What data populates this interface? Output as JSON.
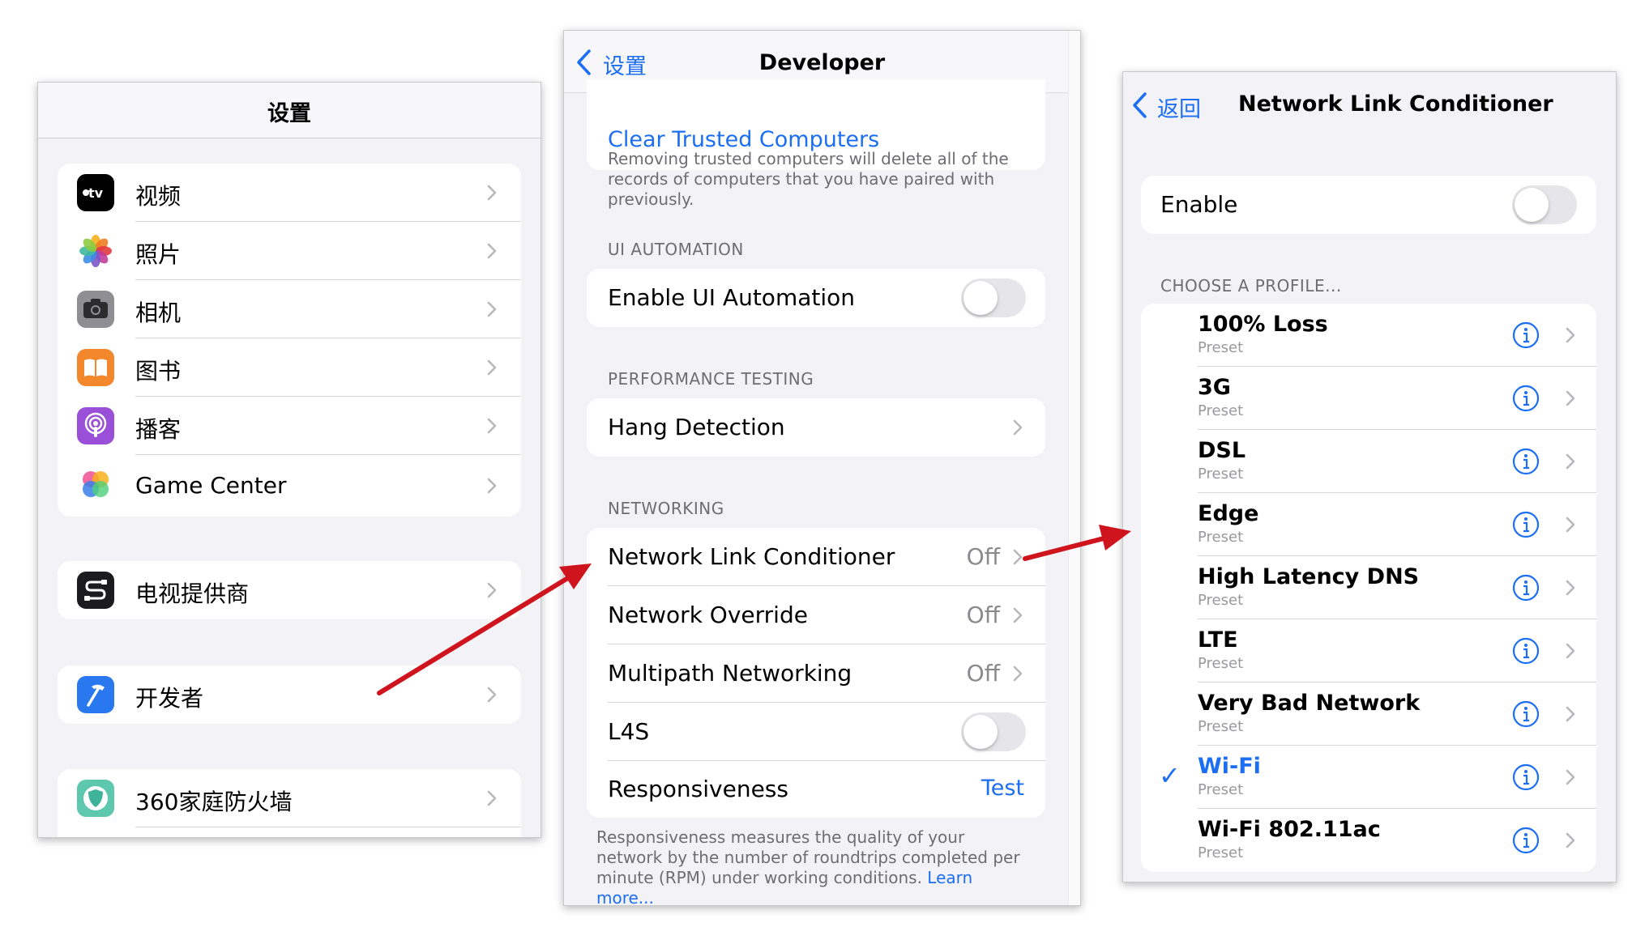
{
  "settings": {
    "title": "设置",
    "group1": [
      {
        "label": "视频",
        "icon": "apple-tv-icon"
      },
      {
        "label": "照片",
        "icon": "photos-icon"
      },
      {
        "label": "相机",
        "icon": "camera-icon"
      },
      {
        "label": "图书",
        "icon": "books-icon"
      },
      {
        "label": "播客",
        "icon": "podcasts-icon"
      },
      {
        "label": "Game Center",
        "icon": "game-center-icon"
      }
    ],
    "tv_provider": {
      "label": "电视提供商",
      "icon": "tv-provider-icon"
    },
    "developer": {
      "label": "开发者",
      "icon": "developer-hammer-icon"
    },
    "firewall": {
      "label": "360家庭防火墙",
      "icon": "firewall-shield-icon"
    }
  },
  "developer_screen": {
    "back_label": "设置",
    "title": "Developer",
    "clear_trusted": "Clear Trusted Computers",
    "clear_trusted_footer": "Removing trusted computers will delete all of the records of computers that you have paired with previously.",
    "ui_automation_header": "UI AUTOMATION",
    "enable_ui_automation": "Enable UI Automation",
    "performance_header": "PERFORMANCE TESTING",
    "hang_detection": "Hang Detection",
    "networking_header": "NETWORKING",
    "network_link_conditioner": {
      "label": "Network Link Conditioner",
      "value": "Off"
    },
    "network_override": {
      "label": "Network Override",
      "value": "Off"
    },
    "multipath": {
      "label": "Multipath Networking",
      "value": "Off"
    },
    "l4s": "L4S",
    "responsiveness": {
      "label": "Responsiveness",
      "action": "Test"
    },
    "responsiveness_footer": "Responsiveness measures the quality of your network by the number of roundtrips completed per minute (RPM) under working conditions.",
    "learn_more": "Learn more..."
  },
  "nlc_screen": {
    "back_label": "返回",
    "title": "Network Link Conditioner",
    "enable_label": "Enable",
    "profile_header": "CHOOSE A PROFILE...",
    "profiles": [
      {
        "name": "100% Loss",
        "sub": "Preset"
      },
      {
        "name": "3G",
        "sub": "Preset"
      },
      {
        "name": "DSL",
        "sub": "Preset"
      },
      {
        "name": "Edge",
        "sub": "Preset"
      },
      {
        "name": "High Latency DNS",
        "sub": "Preset"
      },
      {
        "name": "LTE",
        "sub": "Preset"
      },
      {
        "name": "Very Bad Network",
        "sub": "Preset"
      },
      {
        "name": "Wi-Fi",
        "sub": "Preset",
        "selected": true
      },
      {
        "name": "Wi-Fi 802.11ac",
        "sub": "Preset"
      }
    ],
    "checkmark": "✓"
  },
  "toggles": {
    "enable_ui_automation": false,
    "l4s": false,
    "nlc_enable": false
  },
  "colors": {
    "accent": "#1c6ef2",
    "arrow": "#d0141e",
    "background": "#f2f2f7"
  }
}
